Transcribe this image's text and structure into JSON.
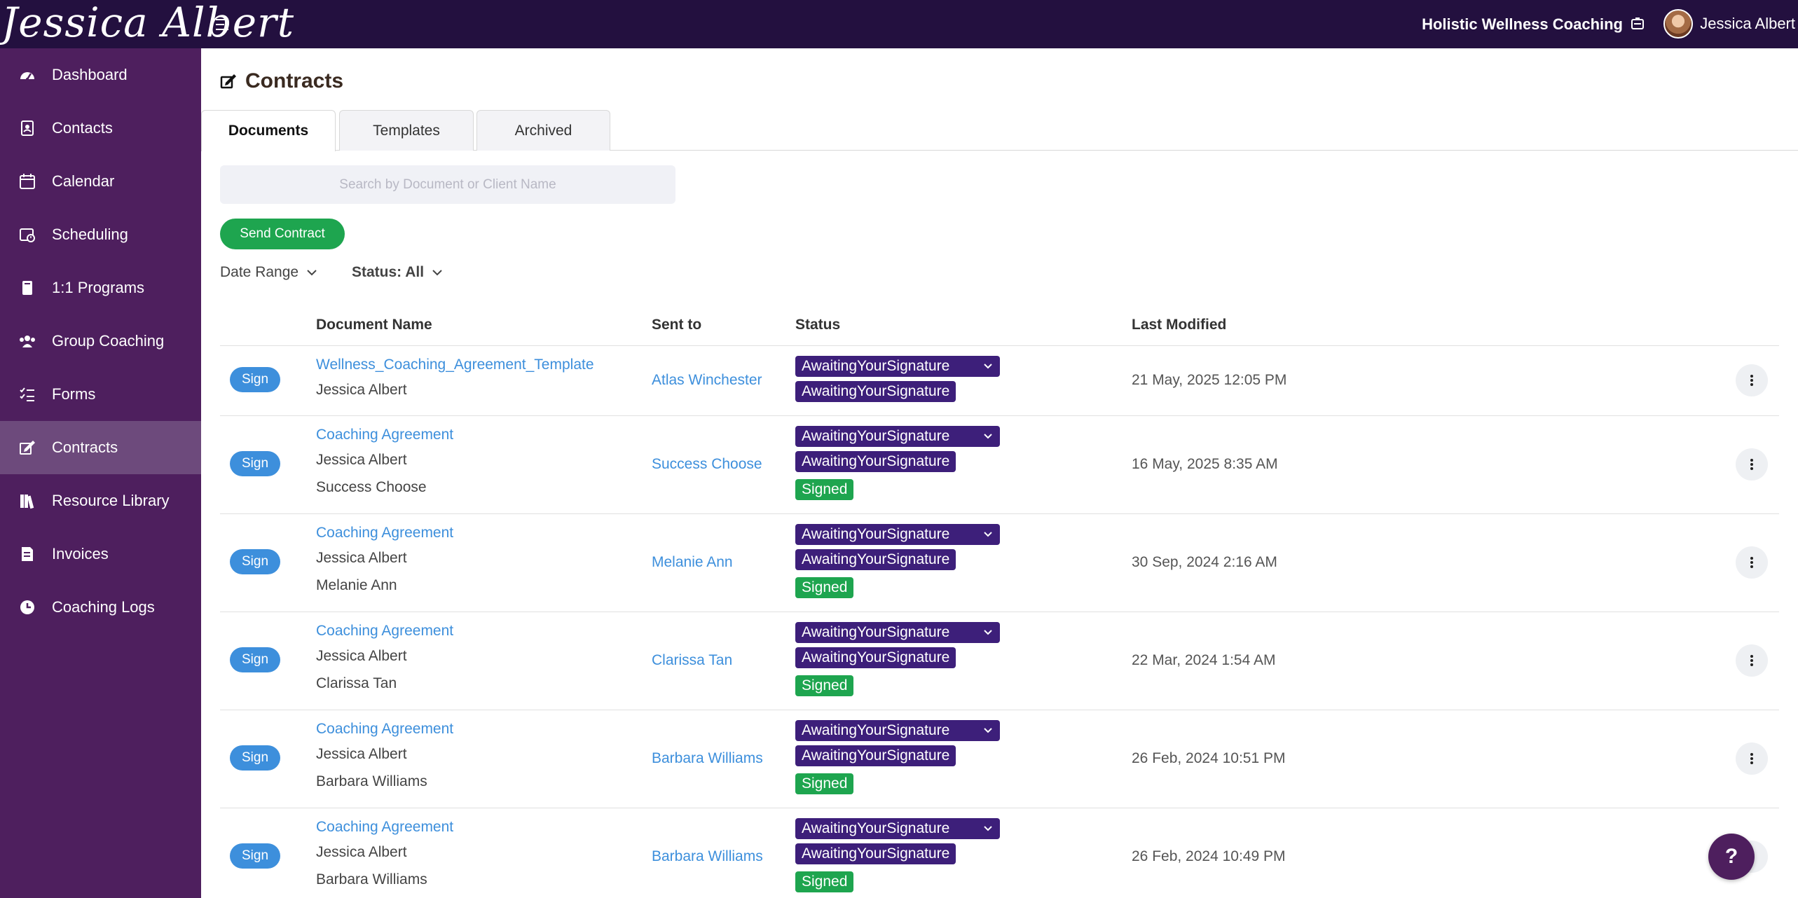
{
  "header": {
    "logo_text": "Jessica Albert",
    "business_name": "Holistic Wellness Coaching",
    "user_name": "Jessica Albert"
  },
  "sidebar": {
    "items": [
      {
        "label": "Dashboard",
        "icon": "dashboard-gauge-icon",
        "active": false
      },
      {
        "label": "Contacts",
        "icon": "contact-book-icon",
        "active": false
      },
      {
        "label": "Calendar",
        "icon": "calendar-icon",
        "active": false
      },
      {
        "label": "Scheduling",
        "icon": "calendar-clock-icon",
        "active": false
      },
      {
        "label": "1:1 Programs",
        "icon": "book-icon",
        "active": false
      },
      {
        "label": "Group Coaching",
        "icon": "users-group-icon",
        "active": false
      },
      {
        "label": "Forms",
        "icon": "checklist-icon",
        "active": false
      },
      {
        "label": "Contracts",
        "icon": "signature-icon",
        "active": true
      },
      {
        "label": "Resource Library",
        "icon": "books-icon",
        "active": false
      },
      {
        "label": "Invoices",
        "icon": "invoice-icon",
        "active": false
      },
      {
        "label": "Coaching Logs",
        "icon": "clock-icon",
        "active": false
      }
    ]
  },
  "page": {
    "title": "Contracts",
    "tabs": [
      {
        "label": "Documents",
        "active": true
      },
      {
        "label": "Templates",
        "active": false
      },
      {
        "label": "Archived",
        "active": false
      }
    ],
    "search_placeholder": "Search by Document or Client Name",
    "send_contract_label": "Send Contract",
    "filters": {
      "date_range_label": "Date Range",
      "status_label": "Status: All"
    }
  },
  "table": {
    "columns": [
      "Document Name",
      "Sent to",
      "Status",
      "Last Modified"
    ],
    "sign_label": "Sign",
    "rows": [
      {
        "document_name": "Wellness_Coaching_Agreement_Template",
        "parties": [
          "Jessica Albert"
        ],
        "sent_to": "Atlas Winchester",
        "statuses": [
          "AwaitingYourSignature",
          "AwaitingYourSignature"
        ],
        "last_modified": "21 May, 2025 12:05 PM"
      },
      {
        "document_name": "Coaching Agreement",
        "parties": [
          "Jessica Albert",
          "Success Choose"
        ],
        "sent_to": "Success Choose",
        "statuses": [
          "AwaitingYourSignature",
          "AwaitingYourSignature",
          "Signed"
        ],
        "last_modified": "16 May, 2025 8:35 AM"
      },
      {
        "document_name": "Coaching Agreement",
        "parties": [
          "Jessica Albert",
          "Melanie Ann"
        ],
        "sent_to": "Melanie Ann",
        "statuses": [
          "AwaitingYourSignature",
          "AwaitingYourSignature",
          "Signed"
        ],
        "last_modified": "30 Sep, 2024 2:16 AM"
      },
      {
        "document_name": "Coaching Agreement",
        "parties": [
          "Jessica Albert",
          "Clarissa Tan"
        ],
        "sent_to": "Clarissa Tan",
        "statuses": [
          "AwaitingYourSignature",
          "AwaitingYourSignature",
          "Signed"
        ],
        "last_modified": "22 Mar, 2024 1:54 AM"
      },
      {
        "document_name": "Coaching Agreement",
        "parties": [
          "Jessica Albert",
          "Barbara Williams"
        ],
        "sent_to": "Barbara Williams",
        "statuses": [
          "AwaitingYourSignature",
          "AwaitingYourSignature",
          "Signed"
        ],
        "last_modified": "26 Feb, 2024 10:51 PM"
      },
      {
        "document_name": "Coaching Agreement",
        "parties": [
          "Jessica Albert",
          "Barbara Williams"
        ],
        "sent_to": "Barbara Williams",
        "statuses": [
          "AwaitingYourSignature",
          "AwaitingYourSignature",
          "Signed"
        ],
        "last_modified": "26 Feb, 2024 10:49 PM"
      }
    ]
  },
  "help_button_label": "?",
  "colors": {
    "topbar": "#23103f",
    "sidebar": "#4e1f5e",
    "sidebar_active": "#6d4a7c",
    "link": "#3d8fdc",
    "awaiting_badge": "#3d1f7a",
    "signed_badge": "#1ea54f"
  }
}
